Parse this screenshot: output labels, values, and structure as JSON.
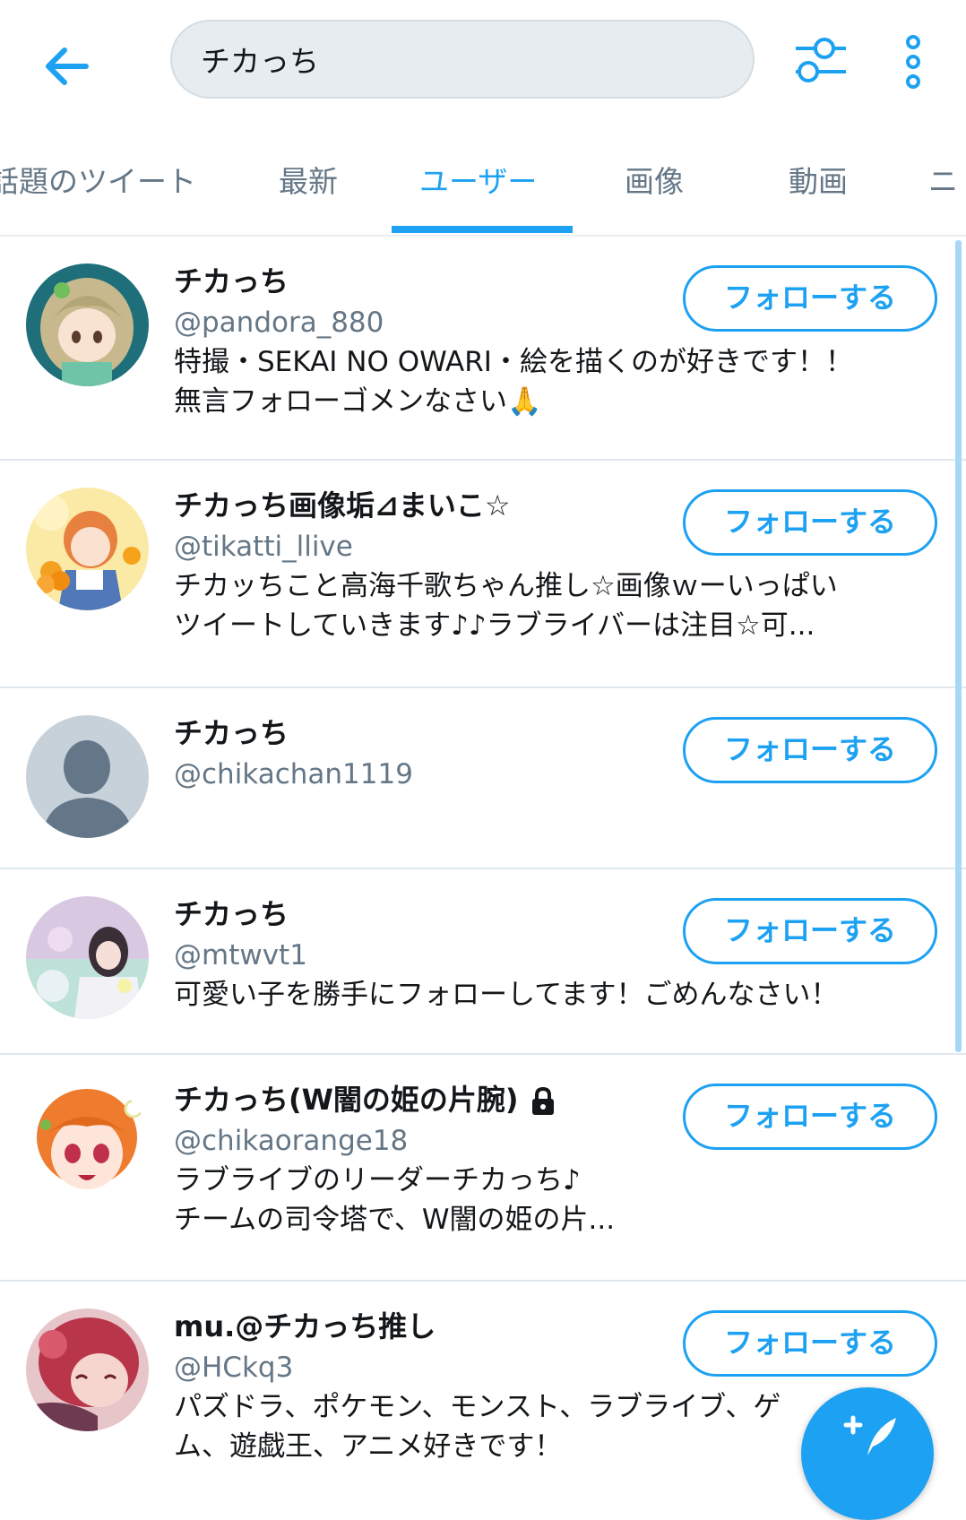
{
  "search": {
    "query": "チカっち"
  },
  "tabs": [
    {
      "label": "話題のツイート",
      "active": false
    },
    {
      "label": "最新",
      "active": false
    },
    {
      "label": "ユーザー",
      "active": true
    },
    {
      "label": "画像",
      "active": false
    },
    {
      "label": "動画",
      "active": false
    },
    {
      "label": "ニ",
      "active": false
    }
  ],
  "users": [
    {
      "name": "チカっち",
      "handle": "@pandora_880",
      "bio": [
        "特撮・SEKAI NO OWARI・絵を描くのが好きです！！",
        "無言フォローゴメンなさい🙏"
      ],
      "follow_label": "フォローする",
      "locked": false
    },
    {
      "name": "チカっち画像垢⊿まいこ☆",
      "handle": "@tikatti_llive",
      "bio": [
        "チカッちこと高海千歌ちゃん推し☆画像ｗーいっぱい",
        "ツイートしていきます♪♪ラブライバーは注目☆可..."
      ],
      "follow_label": "フォローする",
      "locked": false
    },
    {
      "name": "チカっち",
      "handle": "@chikachan1119",
      "bio": [],
      "follow_label": "フォローする",
      "locked": false
    },
    {
      "name": "チカっち",
      "handle": "@mtwvt1",
      "bio": [
        "可愛い子を勝手にフォローしてます！ごめんなさい！"
      ],
      "follow_label": "フォローする",
      "locked": false
    },
    {
      "name": "チカっち(W闇の姫の片腕)",
      "handle": "@chikaorange18",
      "bio": [
        "ラブライブのリーダーチカっち♪",
        "チームの司令塔で、W闇の姫の片..."
      ],
      "follow_label": "フォローする",
      "locked": true
    },
    {
      "name": "mu.@チカっち推し",
      "handle": "@HCkq3",
      "bio": [
        "パズドラ、ポケモン、モンスト、ラブライブ、ゲ",
        "ム、遊戯王、アニメ好きです！"
      ],
      "follow_label": "フォローする",
      "locked": false
    }
  ],
  "colors": {
    "accent": "#1da1f2",
    "secondary_text": "#657786",
    "divider": "#e1e8ed"
  },
  "icons": {
    "back": "arrow-left-icon",
    "filter": "sliders-icon",
    "more": "vertical-dots-icon",
    "lock": "lock-icon",
    "compose": "compose-feather-icon"
  }
}
